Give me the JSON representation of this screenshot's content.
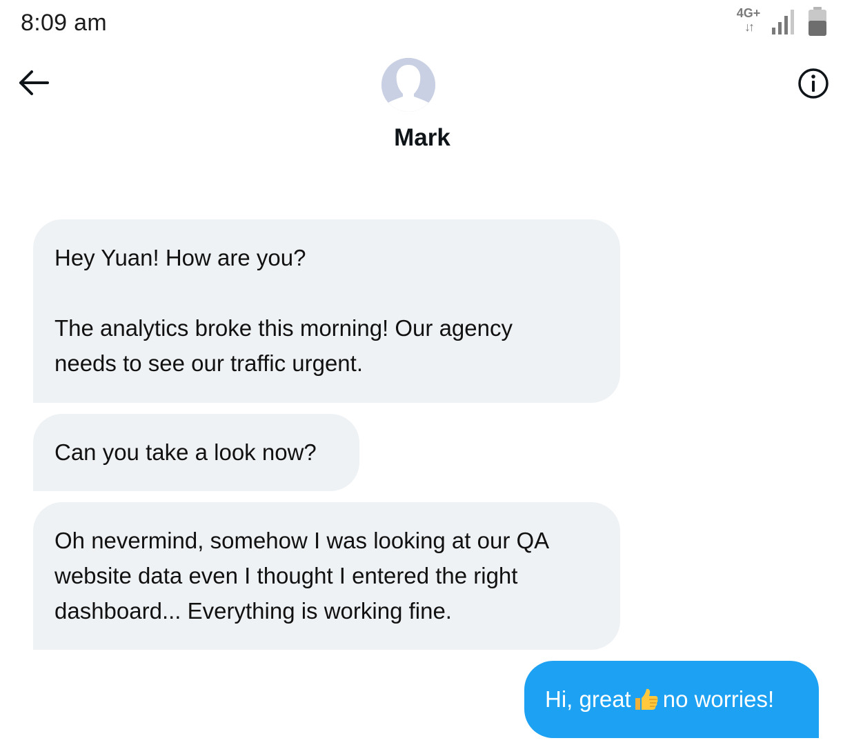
{
  "status_bar": {
    "time": "8:09 am",
    "network_type": "4G+",
    "network_arrows": "↓↑",
    "signal_icon": "signal-bars-icon",
    "battery_icon": "battery-icon"
  },
  "header": {
    "back_icon": "arrow-left-icon",
    "info_icon": "info-circle-icon",
    "avatar_icon": "default-profile-avatar",
    "contact_name": "Mark"
  },
  "messages": [
    {
      "sender": "Mark",
      "direction": "incoming",
      "text": "Hey Yuan! How are you?\n\nThe analytics broke this morning! Our agency\nneeds to see our traffic urgent."
    },
    {
      "sender": "Mark",
      "direction": "incoming",
      "text": "Can you take a look now?"
    },
    {
      "sender": "Mark",
      "direction": "incoming",
      "text": "Oh nevermind, somehow I was looking at our QA\nwebsite data even I thought I entered the right\ndashboard... Everything is working fine."
    },
    {
      "sender": "me",
      "direction": "outgoing",
      "text_before_emoji": "Hi, great",
      "emoji": "thumbs-up-icon",
      "text_after_emoji": "no worries!"
    }
  ],
  "colors": {
    "incoming_bubble": "#eff2f4",
    "outgoing_bubble": "#1da1f2",
    "outgoing_text": "#ffffff",
    "avatar_bg": "#c9d0e3"
  }
}
